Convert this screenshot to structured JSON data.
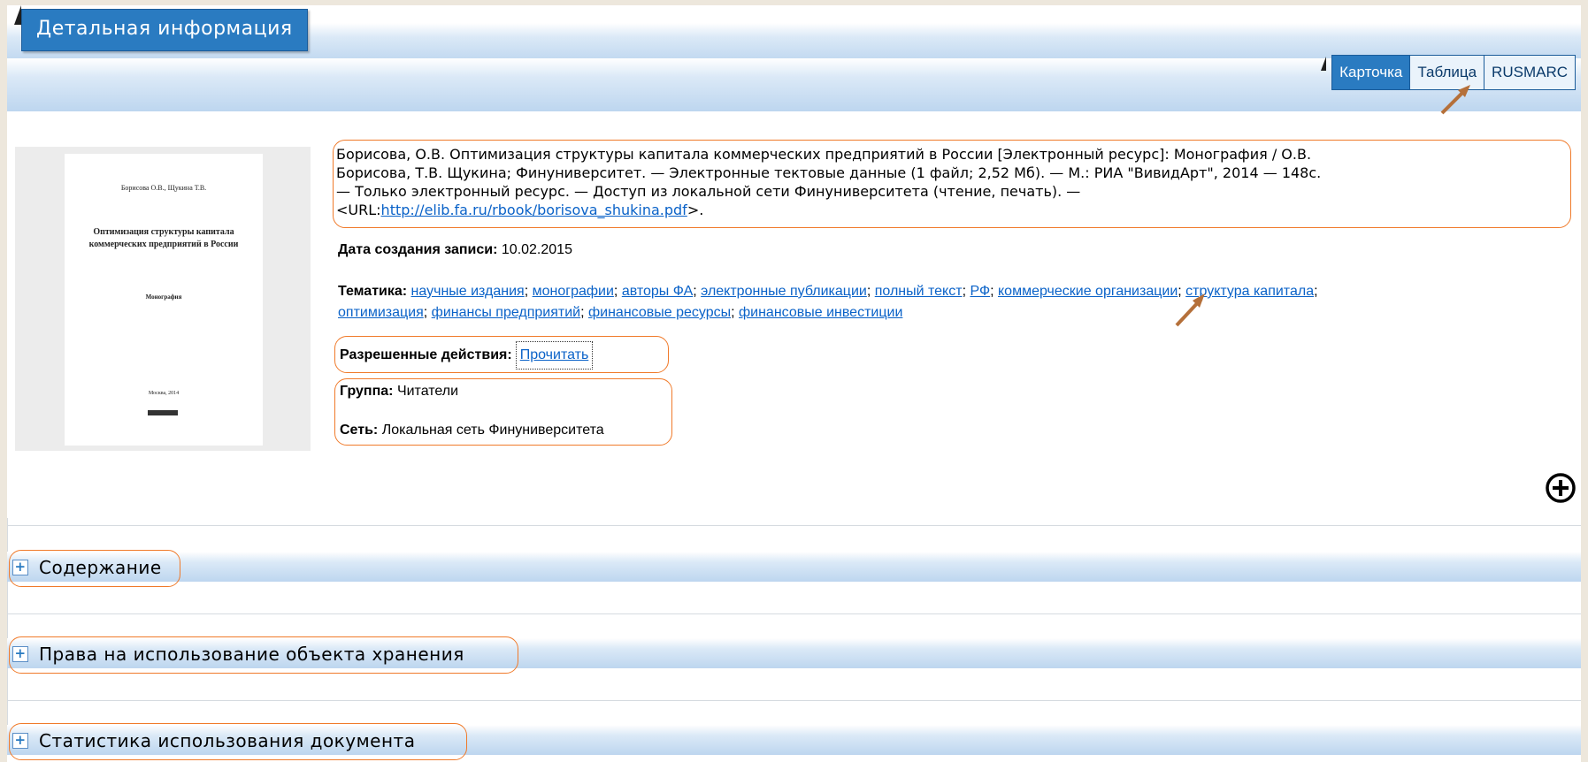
{
  "header": {
    "title": "Детальная информация"
  },
  "view_tabs": [
    {
      "label": "Карточка",
      "active": true
    },
    {
      "label": "Таблица",
      "active": false
    },
    {
      "label": "RUSMARC",
      "active": false
    }
  ],
  "thumbnail": {
    "authors": "Борисова О.В., Щукина Т.В.",
    "title": "Оптимизация структуры капитала коммерческих предприятий в России",
    "subtitle": "Монография",
    "place": "Москва, 2014"
  },
  "record": {
    "description_line1": "Борисова, О.В. Оптимизация структуры капитала коммерческих предприятий в России [Электронный ресурс]: Монография / О.В.",
    "description_line2": "Борисова, Т.В. Щукина; Финуниверситет. — Электронные тектовые данные (1 файл; 2,52 Мб). — М.: РИА \"ВивидАрт\", 2014 — 148с.",
    "description_line3": "— Только электронный ресурс. — Доступ из локальной сети Финуниверситета (чтение, печать). —",
    "url_prefix": "<URL:",
    "url": "http://elib.fa.ru/rbook/borisova_shukina.pdf",
    "url_suffix": ">.",
    "created_label": "Дата создания записи:",
    "created_value": "10.02.2015",
    "topics_label": "Тематика:",
    "topics": [
      "научные издания",
      "монографии",
      "авторы ФА",
      "электронные публикации",
      "полный текст",
      "РФ",
      "коммерческие организации",
      "структура капитала",
      "оптимизация",
      "финансы предприятий",
      "финансовые ресурсы",
      "финансовые инвестиции"
    ],
    "actions_label": "Разрешенные действия:",
    "action_read": "Прочитать",
    "group_label": "Группа:",
    "group_value": "Читатели",
    "network_label": "Сеть:",
    "network_value": "Локальная сеть Финуниверситета"
  },
  "sections": [
    {
      "title": "Содержание",
      "toggle": "+"
    },
    {
      "title": "Права на использование объекта хранения",
      "toggle": "+"
    },
    {
      "title": "Статистика использования документа",
      "toggle": "+"
    }
  ],
  "colors": {
    "accent": "#2a7bc1",
    "annotation": "#f07a2a",
    "link": "#0a62c8",
    "arrow": "#b5703a"
  },
  "icons": {
    "expand": "plus-circle-icon",
    "section_toggle": "plus-box-icon",
    "pointer": "arrow-icon"
  }
}
